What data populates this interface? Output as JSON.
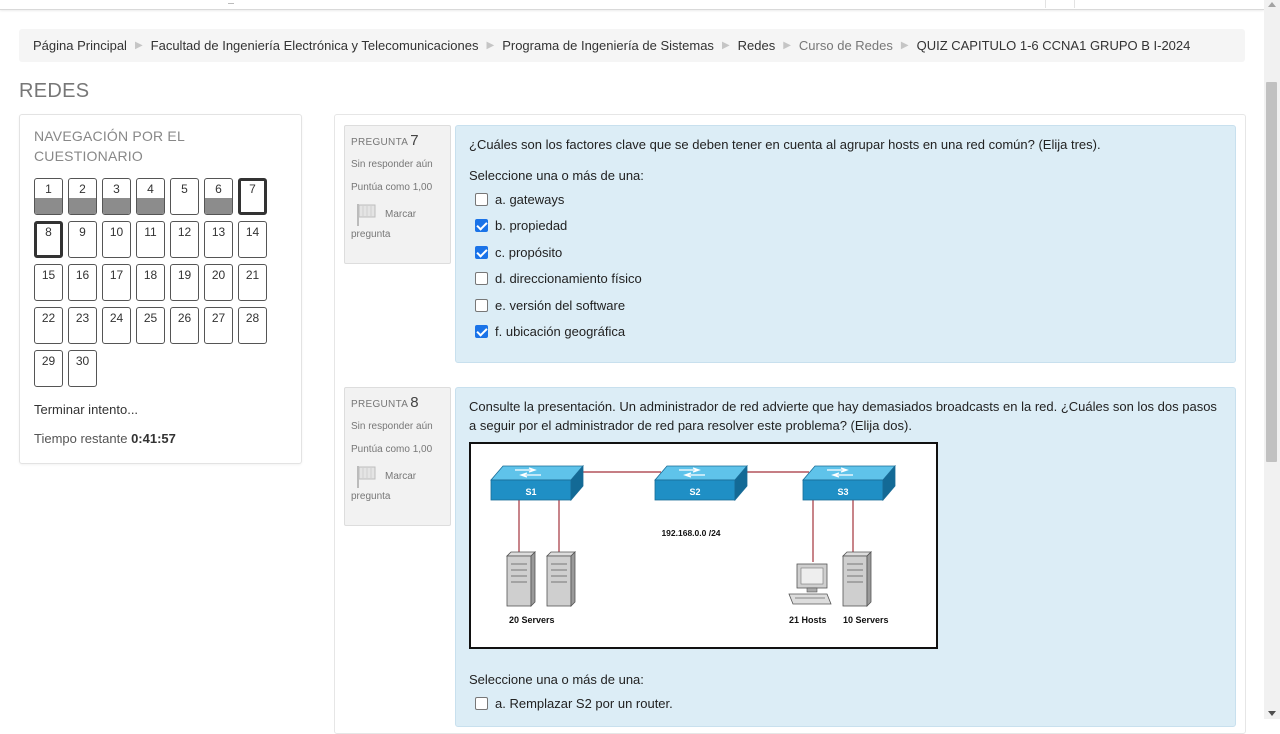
{
  "breadcrumb": [
    {
      "label": "Página Principal",
      "muted": false
    },
    {
      "label": "Facultad de Ingeniería Electrónica y Telecomunicaciones",
      "muted": false
    },
    {
      "label": "Programa de Ingeniería de Sistemas",
      "muted": false
    },
    {
      "label": "Redes",
      "muted": false
    },
    {
      "label": "Curso de Redes",
      "muted": true
    },
    {
      "label": "QUIZ CAPITULO 1-6 CCNA1 GRUPO B I-2024",
      "muted": false
    }
  ],
  "page_heading": "REDES",
  "quiz_nav": {
    "title": "NAVEGACIÓN POR EL CUESTIONARIO",
    "questions": [
      {
        "n": "1",
        "answered": true,
        "current": false
      },
      {
        "n": "2",
        "answered": true,
        "current": false
      },
      {
        "n": "3",
        "answered": true,
        "current": false
      },
      {
        "n": "4",
        "answered": true,
        "current": false
      },
      {
        "n": "5",
        "answered": false,
        "current": false
      },
      {
        "n": "6",
        "answered": true,
        "current": false
      },
      {
        "n": "7",
        "answered": false,
        "current": true
      },
      {
        "n": "8",
        "answered": false,
        "current": true
      },
      {
        "n": "9",
        "answered": false,
        "current": false
      },
      {
        "n": "10",
        "answered": false,
        "current": false
      },
      {
        "n": "11",
        "answered": false,
        "current": false
      },
      {
        "n": "12",
        "answered": false,
        "current": false
      },
      {
        "n": "13",
        "answered": false,
        "current": false
      },
      {
        "n": "14",
        "answered": false,
        "current": false
      },
      {
        "n": "15",
        "answered": false,
        "current": false
      },
      {
        "n": "16",
        "answered": false,
        "current": false
      },
      {
        "n": "17",
        "answered": false,
        "current": false
      },
      {
        "n": "18",
        "answered": false,
        "current": false
      },
      {
        "n": "19",
        "answered": false,
        "current": false
      },
      {
        "n": "20",
        "answered": false,
        "current": false
      },
      {
        "n": "21",
        "answered": false,
        "current": false
      },
      {
        "n": "22",
        "answered": false,
        "current": false
      },
      {
        "n": "23",
        "answered": false,
        "current": false
      },
      {
        "n": "24",
        "answered": false,
        "current": false
      },
      {
        "n": "25",
        "answered": false,
        "current": false
      },
      {
        "n": "26",
        "answered": false,
        "current": false
      },
      {
        "n": "27",
        "answered": false,
        "current": false
      },
      {
        "n": "28",
        "answered": false,
        "current": false
      },
      {
        "n": "29",
        "answered": false,
        "current": false
      },
      {
        "n": "30",
        "answered": false,
        "current": false
      }
    ],
    "finish_label": "Terminar intento...",
    "timer_label": "Tiempo restante",
    "timer_value": "0:41:57"
  },
  "q7": {
    "label": "PREGUNTA",
    "number": "7",
    "state": "Sin responder aún",
    "grade": "Puntúa como 1,00",
    "flag_label": "Marcar",
    "flag_label2": "pregunta",
    "text": "¿Cuáles son los factores clave que se deben tener en cuenta al agrupar hosts en una red común? (Elija tres).",
    "prompt": "Seleccione una o más de una:",
    "options": [
      {
        "label": "a. gateways",
        "checked": false
      },
      {
        "label": "b. propiedad",
        "checked": true
      },
      {
        "label": "c. propósito",
        "checked": true
      },
      {
        "label": "d. direccionamiento físico",
        "checked": false
      },
      {
        "label": "e. versión del software",
        "checked": false
      },
      {
        "label": "f. ubicación geográfica",
        "checked": true
      }
    ]
  },
  "q8": {
    "label": "PREGUNTA",
    "number": "8",
    "state": "Sin responder aún",
    "grade": "Puntúa como 1,00",
    "flag_label": "Marcar",
    "flag_label2": "pregunta",
    "text": "Consulte la presentación. Un administrador de red advierte que hay demasiados broadcasts en la red. ¿Cuáles son los dos pasos a seguir por el administrador de red para resolver este problema? (Elija dos).",
    "diagram": {
      "switch_labels": [
        "S1",
        "S2",
        "S3"
      ],
      "network_label": "192.168.0.0 /24",
      "left_label": "20 Servers",
      "hosts_label": "21 Hosts",
      "right_label": "10 Servers"
    },
    "prompt": "Seleccione una o más de una:",
    "options": [
      {
        "label": "a. Remplazar S2 por un router.",
        "checked": false
      }
    ]
  },
  "colors": {
    "formulation_bg": "#dcedf6",
    "info_bg": "#f2f2f2",
    "checkbox_checked": "#1a73e8",
    "switch_blue": "#1f8fc5"
  }
}
